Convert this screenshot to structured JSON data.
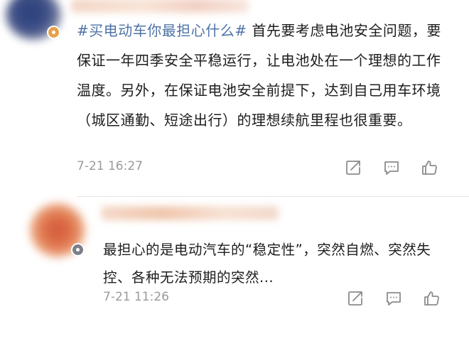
{
  "comments": [
    {
      "topic": "#买电动车你最担心什么#",
      "body": " 首先要考虑电池安全问题，要保证一年四季安全平稳运行，让电池处在一个理想的工作温度。另外，在保证电池安全前提下，达到自己用车环境（城区通勤、短途出行）的理想续航里程也很重要。",
      "time": "7-21 16:27"
    },
    {
      "body": "最担心的是电动汽车的“稳定性”，突然自燃、突然失控、各种无法预期的突然...",
      "time": "7-21 11:26"
    }
  ],
  "icons": {
    "share": "share-icon",
    "comment": "comment-icon",
    "like": "thumbs-up-icon"
  },
  "colors": {
    "topic": "#4e73a6",
    "time": "#9a9a9a",
    "icon": "#8c8c8c"
  }
}
